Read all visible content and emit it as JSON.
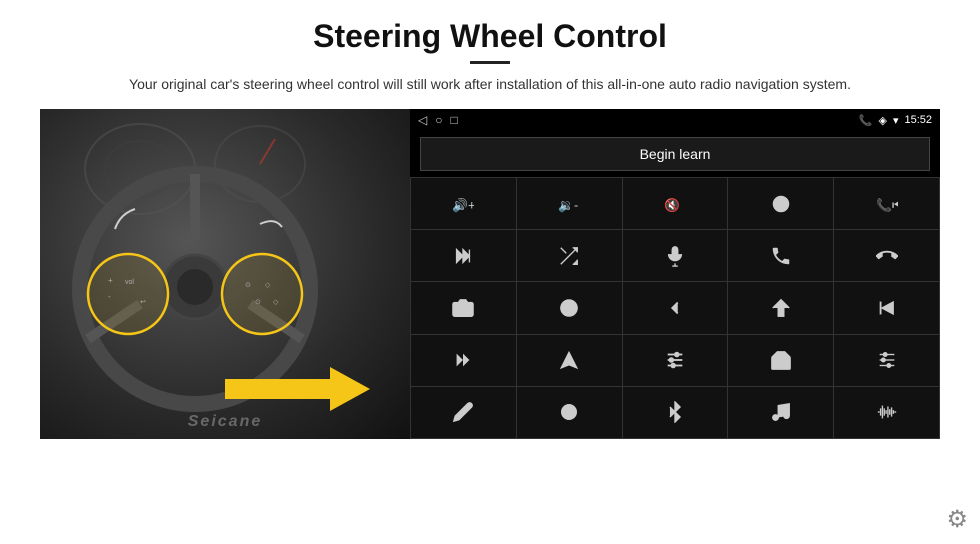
{
  "header": {
    "title": "Steering Wheel Control",
    "subtitle": "Your original car's steering wheel control will still work after installation of this all-in-one auto radio navigation system."
  },
  "status_bar": {
    "time": "15:52",
    "nav_icons": [
      "◁",
      "○",
      "□"
    ]
  },
  "begin_learn_button": "Begin learn",
  "controls": [
    {
      "icon": "vol_up",
      "symbol": "🔊+"
    },
    {
      "icon": "vol_down",
      "symbol": "🔉-"
    },
    {
      "icon": "mute",
      "symbol": "🔇"
    },
    {
      "icon": "power",
      "symbol": "⏻"
    },
    {
      "icon": "prev_track",
      "symbol": "⏮"
    },
    {
      "icon": "next",
      "symbol": "⏭"
    },
    {
      "icon": "shuffle",
      "symbol": "⇄"
    },
    {
      "icon": "mic",
      "symbol": "🎤"
    },
    {
      "icon": "phone",
      "symbol": "📞"
    },
    {
      "icon": "hang_up",
      "symbol": "📵"
    },
    {
      "icon": "camera",
      "symbol": "📷"
    },
    {
      "icon": "360",
      "symbol": "360"
    },
    {
      "icon": "back",
      "symbol": "↩"
    },
    {
      "icon": "home",
      "symbol": "⌂"
    },
    {
      "icon": "skip_prev",
      "symbol": "⏮"
    },
    {
      "icon": "fast_fwd",
      "symbol": "⏩"
    },
    {
      "icon": "navigate",
      "symbol": "➤"
    },
    {
      "icon": "equalizer",
      "symbol": "≑"
    },
    {
      "icon": "radio",
      "symbol": "📻"
    },
    {
      "icon": "sliders",
      "symbol": "⫶"
    },
    {
      "icon": "pen",
      "symbol": "✏"
    },
    {
      "icon": "knob",
      "symbol": "⊙"
    },
    {
      "icon": "bluetooth",
      "symbol": "✦"
    },
    {
      "icon": "music",
      "symbol": "♫"
    },
    {
      "icon": "waveform",
      "symbol": "📶"
    }
  ],
  "seicane_watermark": "Seicane",
  "gear_icon": "⚙"
}
